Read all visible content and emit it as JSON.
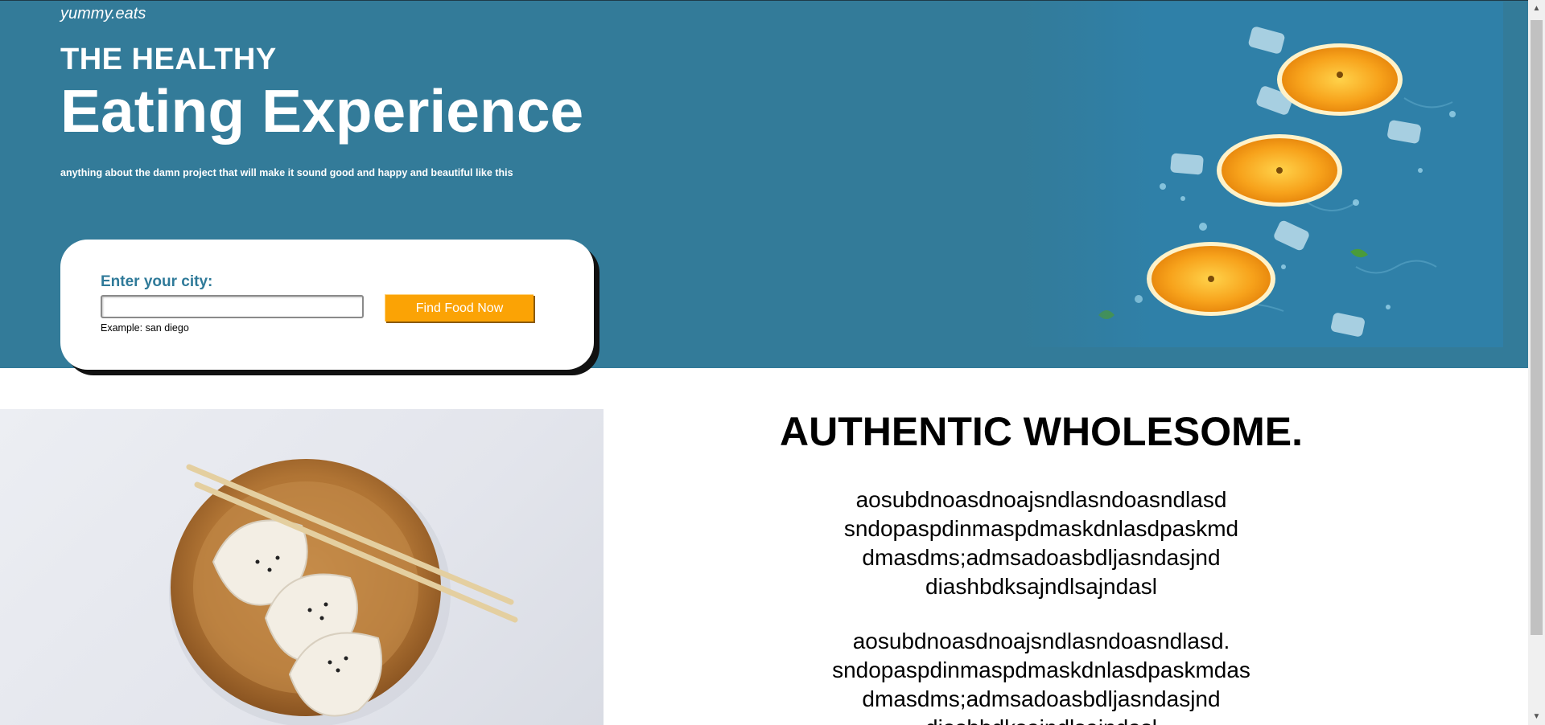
{
  "hero": {
    "brand": "yummy.eats",
    "kicker": "THE HEALTHY",
    "headline": "Eating Experience",
    "tagline": "anything about the damn project that will make it sound good and happy and beautiful like this",
    "search": {
      "label": "Enter your city:",
      "value": "",
      "placeholder": "",
      "button_label": "Find Food Now",
      "example": "Example: san diego"
    },
    "colors": {
      "background": "#337b99",
      "button": "#fba305",
      "label": "#2f7a99"
    }
  },
  "section": {
    "title": "AUTHENTIC WHOLESOME.",
    "paragraph1": [
      "aosubdnoasdnoajsndlasndoasndlasd",
      "sndopaspdinmaspdmaskdnlasdpaskmd",
      "dmasdms;admsadoasbdljasndasjnd",
      "diashbdksajndlsajndasl"
    ],
    "paragraph2": [
      "aosubdnoasdnoajsndlasndoasndlasd.",
      "sndopaspdinmaspdmaskdnlasdpaskmdas",
      "dmasdms;admsadoasbdljasndasjnd",
      "diashbdksajndlsajndasl"
    ]
  },
  "images": {
    "hero_photo": "oranges-on-water-photo",
    "section_photo": "dumplings-with-chopsticks-photo"
  },
  "scrollbar": {
    "up": "▲",
    "down": "▼"
  }
}
